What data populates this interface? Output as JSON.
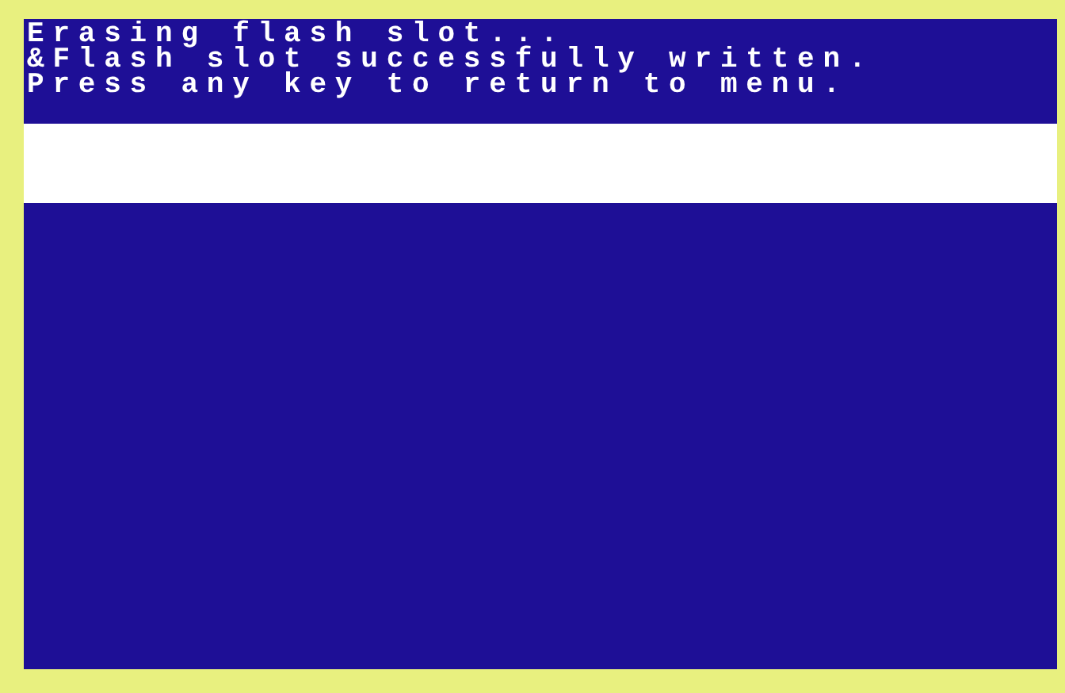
{
  "screen": {
    "lines": [
      "Erasing flash slot...",
      "&Flash slot successfully written.",
      "Press any key to return to menu."
    ]
  }
}
